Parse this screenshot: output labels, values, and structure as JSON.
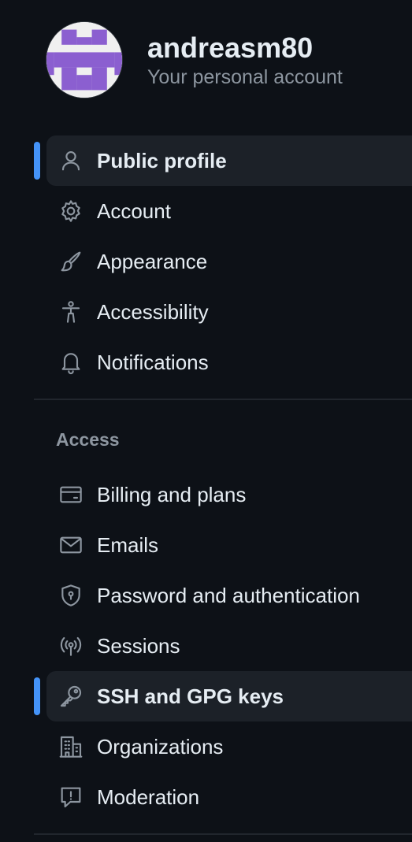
{
  "account": {
    "username": "andreasm80",
    "subtitle": "Your personal account",
    "avatar_color": "#8b5fd0"
  },
  "nav": {
    "items": [
      {
        "label": "Public profile",
        "icon": "person-icon",
        "selected": true
      },
      {
        "label": "Account",
        "icon": "gear-icon",
        "selected": false
      },
      {
        "label": "Appearance",
        "icon": "paintbrush-icon",
        "selected": false
      },
      {
        "label": "Accessibility",
        "icon": "accessibility-icon",
        "selected": false
      },
      {
        "label": "Notifications",
        "icon": "bell-icon",
        "selected": false
      }
    ]
  },
  "access": {
    "heading": "Access",
    "items": [
      {
        "label": "Billing and plans",
        "icon": "credit-card-icon",
        "selected": false
      },
      {
        "label": "Emails",
        "icon": "mail-icon",
        "selected": false
      },
      {
        "label": "Password and authentication",
        "icon": "shield-lock-icon",
        "selected": false
      },
      {
        "label": "Sessions",
        "icon": "broadcast-icon",
        "selected": false
      },
      {
        "label": "SSH and GPG keys",
        "icon": "key-icon",
        "selected": true
      },
      {
        "label": "Organizations",
        "icon": "organization-icon",
        "selected": false
      },
      {
        "label": "Moderation",
        "icon": "report-icon",
        "selected": false
      }
    ]
  },
  "colors": {
    "background": "#0d1117",
    "selected_bg": "#1c2128",
    "accent": "#4493f8",
    "muted_text": "#8d96a0"
  }
}
